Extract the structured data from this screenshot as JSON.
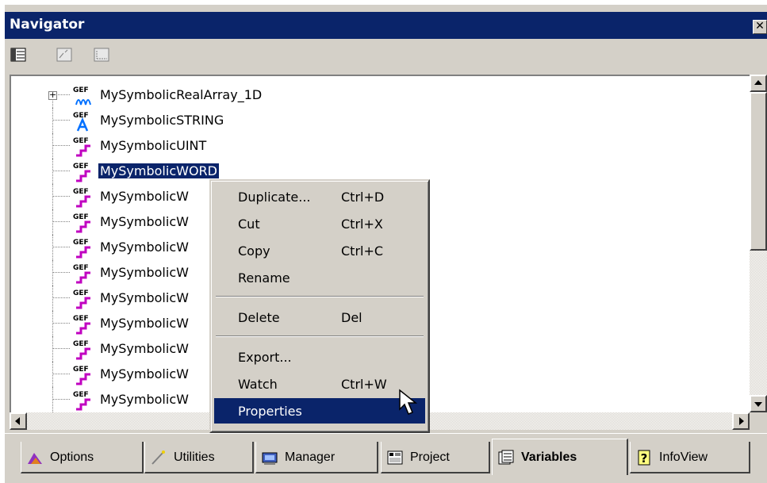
{
  "window": {
    "title": "Navigator",
    "close_glyph": "✕"
  },
  "toolbar": {
    "buttons": [
      "tree-view-icon",
      "filter-icon",
      "list-view-icon"
    ]
  },
  "tree": {
    "expander_glyph": "+",
    "items": [
      {
        "label": "MySymbolicRealArray_1D",
        "icon": "gef-array-icon",
        "expandable": true
      },
      {
        "label": "MySymbolicSTRING",
        "icon": "gef-string-icon"
      },
      {
        "label": "MySymbolicUINT",
        "icon": "gef-int-icon"
      },
      {
        "label": "MySymbolicWORD",
        "icon": "gef-int-icon",
        "selected": true
      },
      {
        "label": "MySymbolicW",
        "icon": "gef-int-icon"
      },
      {
        "label": "MySymbolicW",
        "icon": "gef-int-icon"
      },
      {
        "label": "MySymbolicW",
        "icon": "gef-int-icon"
      },
      {
        "label": "MySymbolicW",
        "icon": "gef-int-icon"
      },
      {
        "label": "MySymbolicW",
        "icon": "gef-int-icon"
      },
      {
        "label": "MySymbolicW",
        "icon": "gef-int-icon"
      },
      {
        "label": "MySymbolicW",
        "icon": "gef-int-icon"
      },
      {
        "label": "MySymbolicW",
        "icon": "gef-int-icon"
      },
      {
        "label": "MySymbolicW",
        "icon": "gef-int-icon"
      }
    ]
  },
  "context_menu": {
    "groups": [
      [
        {
          "label": "Duplicate...",
          "shortcut": "Ctrl+D"
        },
        {
          "label": "Cut",
          "shortcut": "Ctrl+X"
        },
        {
          "label": "Copy",
          "shortcut": "Ctrl+C"
        },
        {
          "label": "Rename",
          "shortcut": ""
        }
      ],
      [
        {
          "label": "Delete",
          "shortcut": "Del"
        }
      ],
      [
        {
          "label": "Export...",
          "shortcut": ""
        },
        {
          "label": "Watch",
          "shortcut": "Ctrl+W"
        },
        {
          "label": "Properties",
          "shortcut": "",
          "highlighted": true
        }
      ]
    ]
  },
  "tabs": [
    {
      "label": "Options",
      "icon": "options-icon"
    },
    {
      "label": "Utilities",
      "icon": "utilities-icon"
    },
    {
      "label": "Manager",
      "icon": "manager-icon"
    },
    {
      "label": "Project",
      "icon": "project-icon"
    },
    {
      "label": "Variables",
      "icon": "variables-icon",
      "active": true
    },
    {
      "label": "InfoView",
      "icon": "infoview-icon"
    }
  ],
  "colors": {
    "title_bar": "#0a246a",
    "selection": "#0a246a",
    "face": "#d4d0c8",
    "gef_icon_magenta": "#c000c0",
    "gef_icon_blue": "#0070ff"
  }
}
